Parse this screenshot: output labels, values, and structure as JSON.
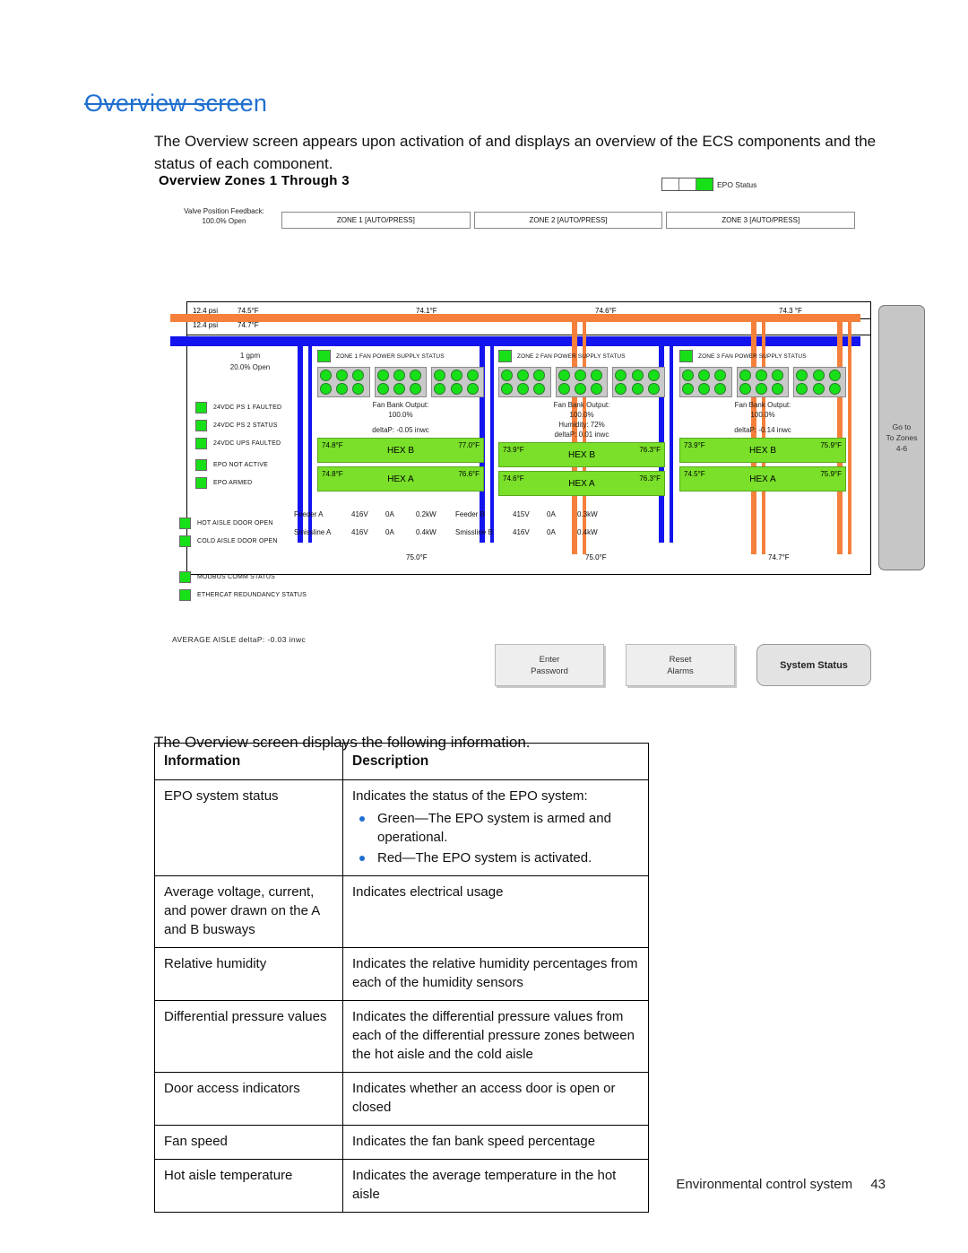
{
  "document": {
    "title": "Overview screen",
    "intro": "The Overview screen appears upon activation of and displays an overview of the ECS components and the status of each component.",
    "mid": "The Overview screen displays the following information.",
    "footer_text": "Environmental control system",
    "page_number": "43"
  },
  "screenshot": {
    "title": "Overview Zones 1 Through 3",
    "epo_status_label": "EPO Status",
    "valve_feedback": {
      "label": "Valve Position Feedback:",
      "value": "100.0% Open"
    },
    "zone_headers": [
      "ZONE 1 [AUTO/PRESS]",
      "ZONE 2 [AUTO/PRESS]",
      "ZONE 3 [AUTO/PRESS]"
    ],
    "supply_row": {
      "psi": "12.4 psi",
      "temp": "74.5°F",
      "zone1": "74.1°F",
      "zone2": "74.6°F",
      "zone3": "74.3 °F"
    },
    "return_row": {
      "psi": "12.4 psi",
      "temp": "74.7°F"
    },
    "gauges": {
      "flow": "1 gpm",
      "valve": "20.0% Open"
    },
    "left_lamps": [
      "24VDC PS 1 FAULTED",
      "24VDC PS 2 STATUS",
      "24VDC UPS  FAULTED",
      "EPO NOT ACTIVE",
      "EPO ARMED"
    ],
    "zones": [
      {
        "ps_label": "ZONE 1 FAN POWER SUPPLY STATUS",
        "fan_bank_label": "Fan Bank Output:",
        "fan_bank_value": "100.0%",
        "humidity": "",
        "deltap": "deltaP: -0.05 inwc",
        "hex_b": {
          "name": "HEX B",
          "left": "74.8°F",
          "right": "77.0°F"
        },
        "hex_a": {
          "name": "HEX A",
          "left": "74.8°F",
          "right": "76.6°F"
        },
        "bottom_temp": "75.0°F"
      },
      {
        "ps_label": "ZONE 2 FAN POWER SUPPLY STATUS",
        "fan_bank_label": "Fan Bank Output:",
        "fan_bank_value": "100.0%",
        "humidity": "Humidity: 72%",
        "deltap": "deltaP: 0.01 inwc",
        "hex_b": {
          "name": "HEX B",
          "left": "73.9°F",
          "right": "76.3°F"
        },
        "hex_a": {
          "name": "HEX A",
          "left": "74.6°F",
          "right": "76.3°F"
        },
        "bottom_temp": "75.0°F"
      },
      {
        "ps_label": "ZONE 3 FAN POWER SUPPLY STATUS",
        "fan_bank_label": "Fan Bank Output:",
        "fan_bank_value": "100.0%",
        "humidity": "",
        "deltap": "deltaP: -0.14 inwc",
        "hex_b": {
          "name": "HEX B",
          "left": "73.9°F",
          "right": "75.9°F"
        },
        "hex_a": {
          "name": "HEX A",
          "left": "74.5°F",
          "right": "75.9°F"
        },
        "bottom_temp": "74.7°F"
      }
    ],
    "electrical": [
      {
        "name": "Feeder A",
        "volts": "416V",
        "amps": "0A",
        "watts": "0.2kW"
      },
      {
        "name": "Feeder B",
        "volts": "415V",
        "amps": "0A",
        "watts": "0.3kW"
      },
      {
        "name": "Smissline A",
        "volts": "416V",
        "amps": "0A",
        "watts": "0.4kW"
      },
      {
        "name": "Smissline B",
        "volts": "416V",
        "amps": "0A",
        "watts": "0.4kW"
      }
    ],
    "goto_button": "Go to\nTo Zones\n4-6",
    "lower_lamps": [
      "HOT AISLE DOOR OPEN",
      "COLD AISLE DOOR OPEN",
      "MODBUS COMM STATUS",
      "ETHERCAT REDUNDANCY STATUS"
    ],
    "average_aisle_dp": "AVERAGE AISLE deltaP: -0.03 inwc",
    "buttons": {
      "enter_password": "Enter\nPassword",
      "reset_alarms": "Reset\nAlarms",
      "system_status": "System Status"
    },
    "colors": {
      "lamp_green": "#18e018",
      "pipe_hot": "#f4803c",
      "pipe_cold": "#1414ee",
      "hex_green": "#7ae02a"
    }
  },
  "table": {
    "headers": [
      "Information",
      "Description"
    ],
    "rows": [
      {
        "info": "EPO system status",
        "desc": "Indicates the status of the EPO system:",
        "bullets": [
          "Green—The EPO system is armed and operational.",
          "Red—The EPO system is activated."
        ]
      },
      {
        "info": "Average voltage, current, and power drawn on the A and B busways",
        "desc": "Indicates electrical usage",
        "bullets": []
      },
      {
        "info": "Relative humidity",
        "desc": "Indicates the relative humidity percentages from each of the humidity sensors",
        "bullets": []
      },
      {
        "info": "Differential pressure values",
        "desc": "Indicates the differential pressure values from each of the differential pressure zones between the hot aisle and the cold aisle",
        "bullets": []
      },
      {
        "info": "Door access indicators",
        "desc": "Indicates whether an access door is open or closed",
        "bullets": []
      },
      {
        "info": "Fan speed",
        "desc": "Indicates the fan bank speed percentage",
        "bullets": []
      },
      {
        "info": "Hot aisle temperature",
        "desc": "Indicates the average temperature in the hot aisle",
        "bullets": []
      }
    ]
  }
}
